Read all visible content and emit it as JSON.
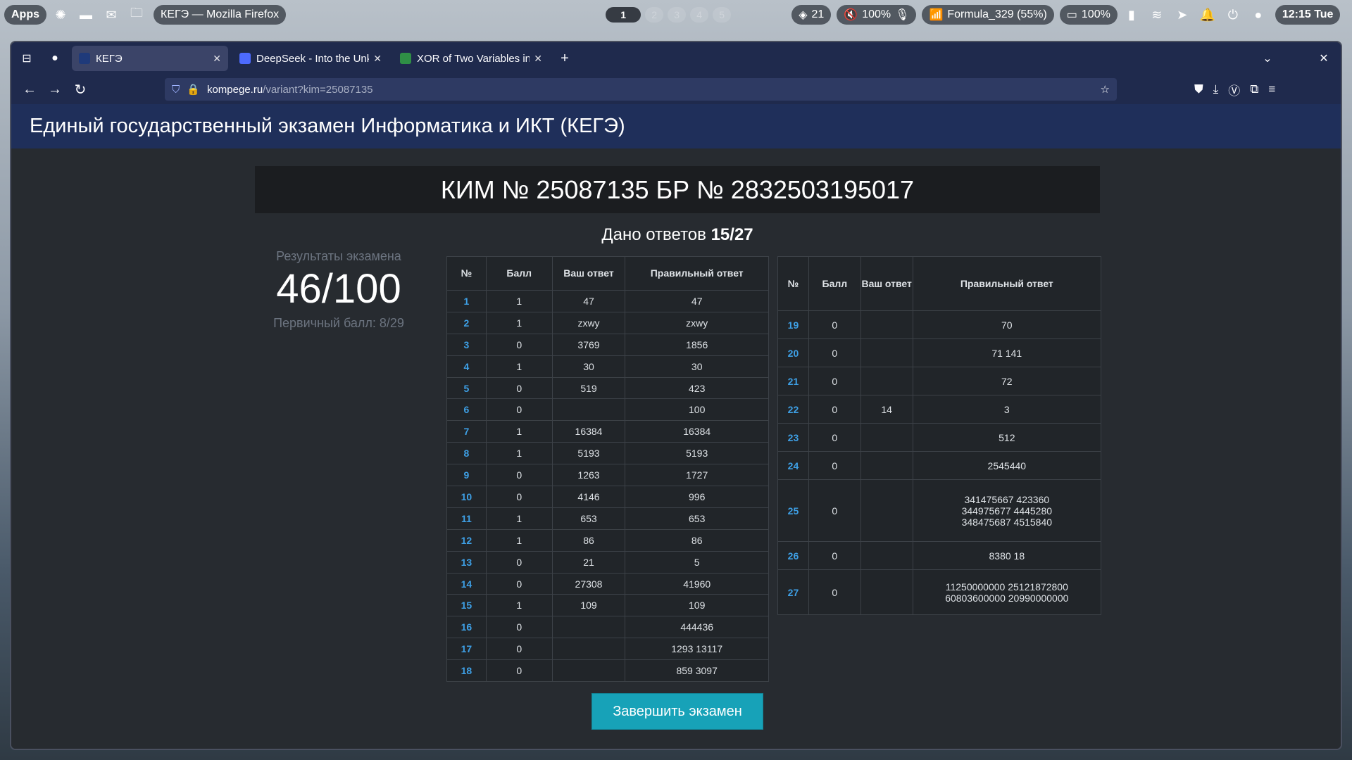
{
  "panel": {
    "apps_label": "Apps",
    "window_title": "КЕГЭ — Mozilla Firefox",
    "workspaces": [
      "1",
      "2",
      "3",
      "4",
      "5"
    ],
    "updates": "21",
    "volume": "100%",
    "wifi": "Formula_329 (55%)",
    "battery": "100%",
    "clock": "12:15 Tue"
  },
  "browser": {
    "tabs": [
      {
        "label": "КЕГЭ",
        "active": true
      },
      {
        "label": "DeepSeek - Into the Unkn",
        "active": false
      },
      {
        "label": "XOR of Two Variables in P",
        "active": false
      }
    ],
    "url_host": "kompege.ru",
    "url_path": "/variant?kim=25087135"
  },
  "page": {
    "header_title": "Единый государственный экзамен Информатика и ИКТ (КЕГЭ)",
    "kim_title": "КИМ № 25087135 БР № 2832503195017",
    "answers_given_label": "Дано ответов",
    "answers_given_value": "15/27",
    "results_caption": "Результаты экзамена",
    "score": "46/100",
    "primary_score": "Первичный балл: 8/29",
    "finish_button": "Завершить экзамен"
  },
  "table_headers": {
    "num": "№",
    "points": "Балл",
    "your_answer": "Ваш ответ",
    "correct_answer": "Правильный ответ"
  },
  "rows_left": [
    {
      "n": "1",
      "p": "1",
      "a": "47",
      "c": "47"
    },
    {
      "n": "2",
      "p": "1",
      "a": "zxwy",
      "c": "zxwy"
    },
    {
      "n": "3",
      "p": "0",
      "a": "3769",
      "c": "1856"
    },
    {
      "n": "4",
      "p": "1",
      "a": "30",
      "c": "30"
    },
    {
      "n": "5",
      "p": "0",
      "a": "519",
      "c": "423"
    },
    {
      "n": "6",
      "p": "0",
      "a": "",
      "c": "100"
    },
    {
      "n": "7",
      "p": "1",
      "a": "16384",
      "c": "16384"
    },
    {
      "n": "8",
      "p": "1",
      "a": "5193",
      "c": "5193"
    },
    {
      "n": "9",
      "p": "0",
      "a": "1263",
      "c": "1727"
    },
    {
      "n": "10",
      "p": "0",
      "a": "4146",
      "c": "996"
    },
    {
      "n": "11",
      "p": "1",
      "a": "653",
      "c": "653"
    },
    {
      "n": "12",
      "p": "1",
      "a": "86",
      "c": "86"
    },
    {
      "n": "13",
      "p": "0",
      "a": "21",
      "c": "5"
    },
    {
      "n": "14",
      "p": "0",
      "a": "27308",
      "c": "41960"
    },
    {
      "n": "15",
      "p": "1",
      "a": "109",
      "c": "109"
    },
    {
      "n": "16",
      "p": "0",
      "a": "",
      "c": "444436"
    },
    {
      "n": "17",
      "p": "0",
      "a": "",
      "c": "1293 13117"
    },
    {
      "n": "18",
      "p": "0",
      "a": "",
      "c": "859 3097"
    }
  ],
  "rows_right": [
    {
      "n": "19",
      "p": "0",
      "a": "",
      "c": [
        "70"
      ]
    },
    {
      "n": "20",
      "p": "0",
      "a": "",
      "c": [
        "71 141"
      ]
    },
    {
      "n": "21",
      "p": "0",
      "a": "",
      "c": [
        "72"
      ]
    },
    {
      "n": "22",
      "p": "0",
      "a": "14",
      "c": [
        "3"
      ]
    },
    {
      "n": "23",
      "p": "0",
      "a": "",
      "c": [
        "512"
      ]
    },
    {
      "n": "24",
      "p": "0",
      "a": "",
      "c": [
        "2545440"
      ]
    },
    {
      "n": "25",
      "p": "0",
      "a": "",
      "c": [
        "341475667 423360",
        "344975677 4445280",
        "348475687 4515840"
      ]
    },
    {
      "n": "26",
      "p": "0",
      "a": "",
      "c": [
        "8380 18"
      ]
    },
    {
      "n": "27",
      "p": "0",
      "a": "",
      "c": [
        "11250000000 25121872800",
        "60803600000 20990000000"
      ]
    }
  ]
}
